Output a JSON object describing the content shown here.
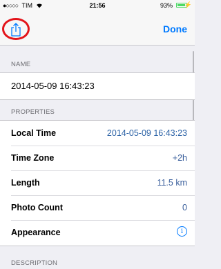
{
  "status_bar": {
    "carrier": "TIM",
    "signal_dots": "●○○○○",
    "wifi_icon": "wifi-icon",
    "time": "21:56",
    "battery": "93%",
    "charge_icon": "⚡"
  },
  "nav": {
    "share_icon": "share-icon",
    "done_label": "Done",
    "accent_color": "#007aff",
    "highlight_circle_color": "#e3141a"
  },
  "name_section": {
    "header": "NAME",
    "value": "2014-05-09 16:43:23"
  },
  "properties_section": {
    "header": "PROPERTIES",
    "rows": [
      {
        "label": "Local Time",
        "value": "2014-05-09 16:43:23"
      },
      {
        "label": "Time Zone",
        "value": "+2h"
      },
      {
        "label": "Length",
        "value": "11.5 km"
      },
      {
        "label": "Photo Count",
        "value": "0"
      },
      {
        "label": "Appearance",
        "icon": "info-icon"
      }
    ]
  },
  "description_section": {
    "header": "DESCRIPTION"
  }
}
